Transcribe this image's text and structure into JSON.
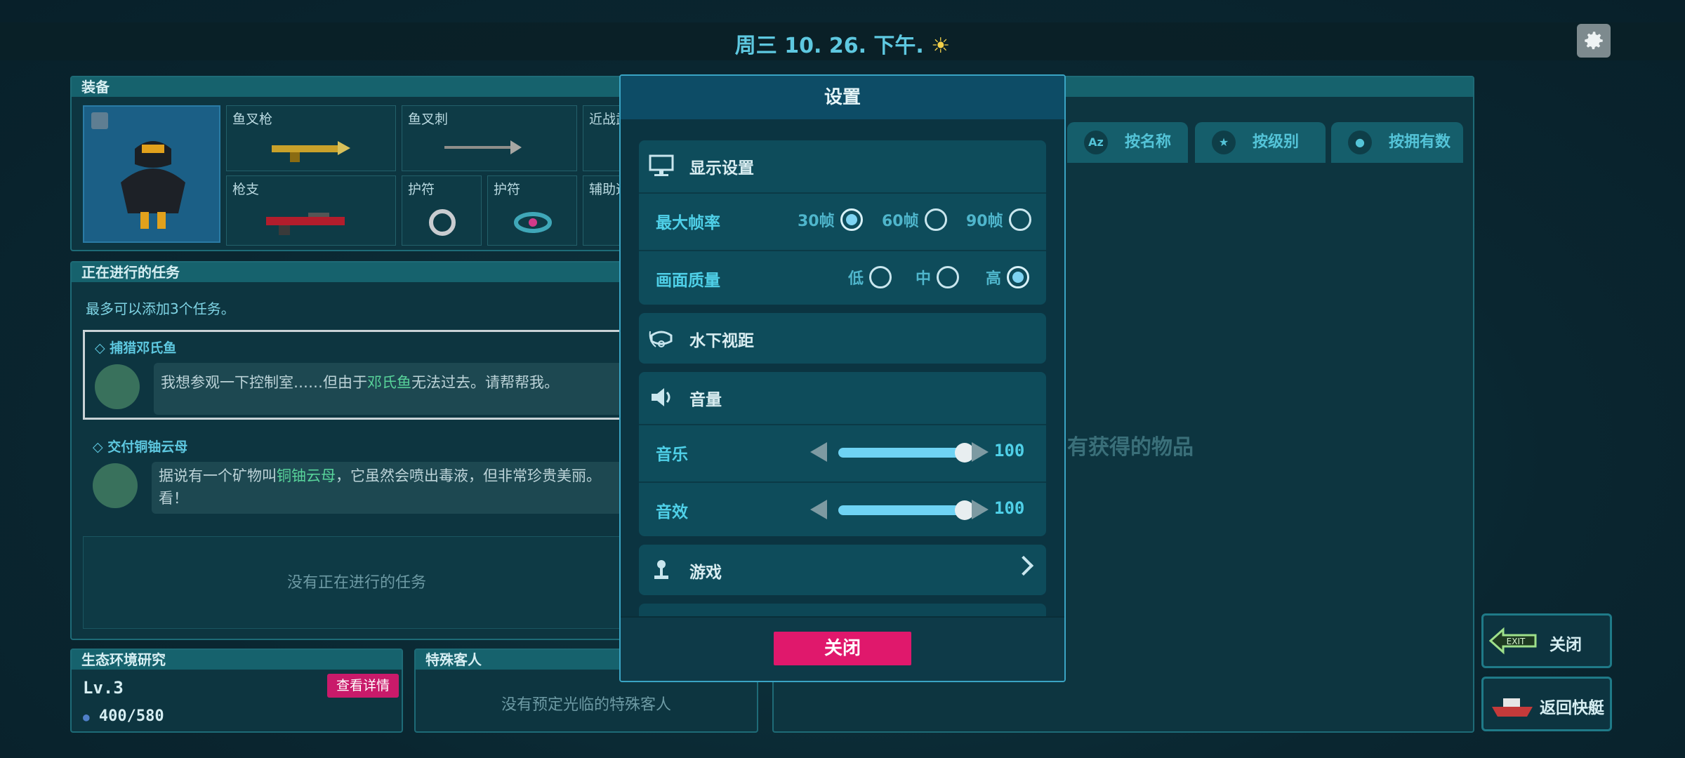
{
  "header": {
    "date_text": "周三 10. 26. 下午.",
    "weather_glyph": "☀"
  },
  "equipment": {
    "title": "装备",
    "slots": [
      {
        "label": "鱼叉枪"
      },
      {
        "label": "鱼叉刺"
      },
      {
        "label": "近战武"
      },
      {
        "label": "枪支"
      },
      {
        "label": "护符"
      },
      {
        "label": "护符"
      },
      {
        "label": "辅助道"
      }
    ]
  },
  "tasks": {
    "title": "正在进行的任务",
    "hint": "最多可以添加3个任务。",
    "items": [
      {
        "title": "捕猎邓氏鱼",
        "text_before": "我想参观一下控制室……但由于",
        "highlight": "邓氏鱼",
        "text_after": "无法过去。请帮帮我。"
      },
      {
        "title": "交付铜铀云母",
        "text_before": "据说有一个矿物叫",
        "highlight": "铜铀云母",
        "text_after": "，它虽然会喷出毒液，但非常珍贵美丽。",
        "text_line2": "看！"
      }
    ],
    "empty_text": "没有正在进行的任务"
  },
  "eco": {
    "title": "生态环境研究",
    "level": "Lv.3",
    "detail_label": "查看详情",
    "points": "400/580"
  },
  "guest": {
    "title": "特殊客人",
    "empty_text": "没有预定光临的特殊客人"
  },
  "inventory": {
    "tabs": [
      {
        "icon": "Az",
        "label": "按名称"
      },
      {
        "icon": "★",
        "label": "按级别"
      },
      {
        "icon": "●",
        "label": "按拥有数"
      }
    ],
    "empty_text": "有获得的物品"
  },
  "side_buttons": {
    "exit_tag": "EXIT",
    "exit_label": "关闭",
    "back_label": "返回快艇"
  },
  "settings": {
    "title": "设置",
    "display": {
      "title": "显示设置",
      "fps_label": "最大帧率",
      "fps_options": [
        "30帧",
        "60帧",
        "90帧"
      ],
      "fps_selected": "30帧",
      "quality_label": "画面质量",
      "quality_options": [
        "低",
        "中",
        "高"
      ],
      "quality_selected": "高"
    },
    "underwater": {
      "title": "水下视距"
    },
    "volume": {
      "title": "音量",
      "music_label": "音乐",
      "music_value": "100",
      "sfx_label": "音效",
      "sfx_value": "100"
    },
    "game": {
      "title": "游戏"
    },
    "close_label": "关闭"
  },
  "colors": {
    "accent": "#5ec8e0",
    "close_button": "#e0186c",
    "highlight_text": "#58d39a",
    "selected_radio": "#7ed3f2"
  }
}
